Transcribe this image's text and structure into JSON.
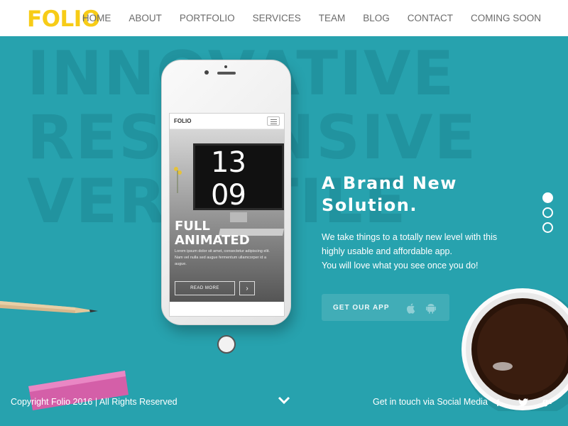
{
  "header": {
    "logo": "FOLIO",
    "nav": [
      "HOME",
      "ABOUT",
      "PORTFOLIO",
      "SERVICES",
      "TEAM",
      "BLOG",
      "CONTACT",
      "COMING SOON"
    ]
  },
  "hero": {
    "background_words": [
      "INNOVATIVE",
      "RESPONSIVE",
      "VERSATILE"
    ],
    "headline": [
      "A Brand New",
      "Solution."
    ],
    "description": [
      "We take things to a totally new level with this",
      "highly usable and affordable app.",
      "You will love what you see once you do!"
    ],
    "app_button": "GET OUR APP",
    "slider_active": 1,
    "slider_count": 3
  },
  "phone_screen": {
    "logo": "FOLIO",
    "clock": "13 09",
    "title": [
      "FULL",
      "ANIMATED"
    ],
    "body": "Lorem ipsum dolor sit amet, consectetur adipiscing elit. Nam vel nulla sed augue fermentum ullamcorper id a augue.",
    "read_more": "READ MORE"
  },
  "footer": {
    "copyright": "Copyright Folio 2016 | All Rights Reserved",
    "social_text": "Get in touch via Social Media",
    "social_icons": [
      "facebook-icon",
      "twitter-icon",
      "google-plus-icon"
    ]
  },
  "colors": {
    "accent": "#f7cc17",
    "hero_bg": "#27a2ae",
    "header_bg": "#ffffff"
  }
}
